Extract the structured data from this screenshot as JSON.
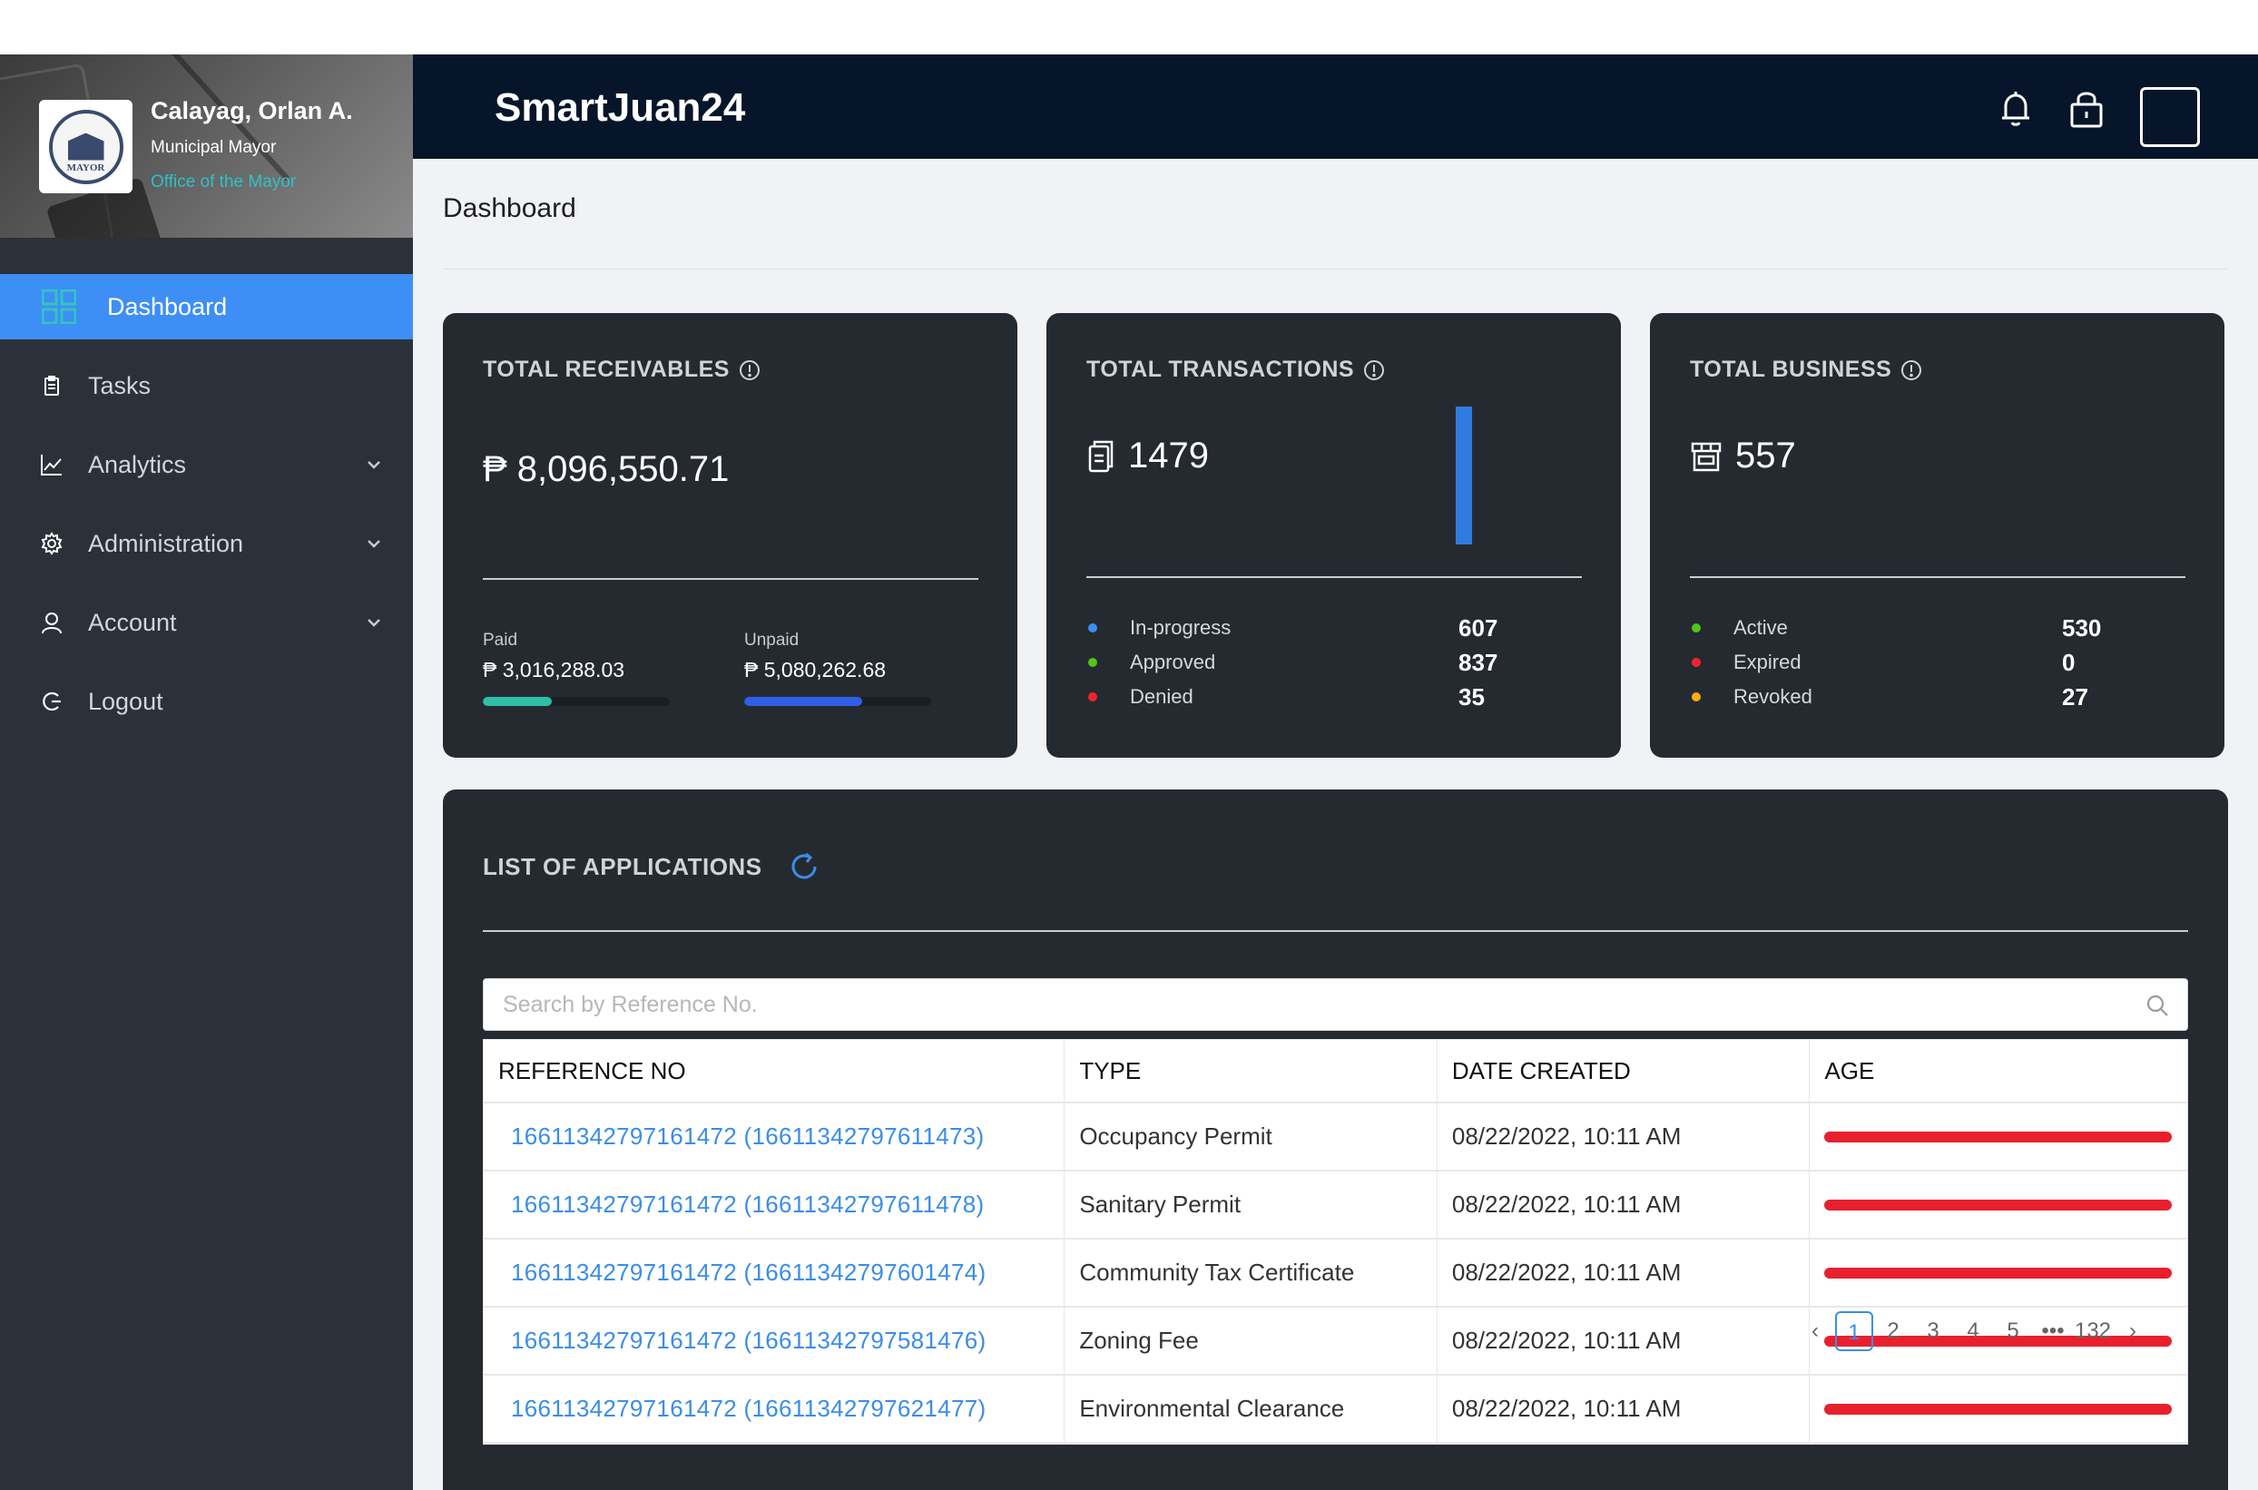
{
  "app": {
    "brand": "SmartJuan24"
  },
  "profile": {
    "name": "Calayag, Orlan A.",
    "role": "Municipal Mayor",
    "office": "Office of the Mayor",
    "seal_text": "MAYOR"
  },
  "sidebar": {
    "items": [
      {
        "label": "Dashboard",
        "icon": "dashboard-grid-icon",
        "active": true
      },
      {
        "label": "Tasks",
        "icon": "clipboard-icon"
      },
      {
        "label": "Analytics",
        "icon": "line-chart-icon",
        "expandable": true
      },
      {
        "label": "Administration",
        "icon": "gear-icon",
        "expandable": true
      },
      {
        "label": "Account",
        "icon": "user-icon",
        "expandable": true
      },
      {
        "label": "Logout",
        "icon": "logout-icon"
      }
    ]
  },
  "header": {
    "icons": [
      "bell-icon",
      "lock-icon",
      "menu-box-icon"
    ]
  },
  "page": {
    "title": "Dashboard"
  },
  "cards": {
    "receivables": {
      "title": "TOTAL RECEIVABLES",
      "amount": "₱ 8,096,550.71",
      "paid_label": "Paid",
      "paid_value": "₱ 3,016,288.03",
      "paid_progress": 0.37,
      "unpaid_label": "Unpaid",
      "unpaid_value": "₱ 5,080,262.68",
      "unpaid_progress": 0.63
    },
    "transactions": {
      "title": "TOTAL TRANSACTIONS",
      "total": "1479",
      "rows": [
        {
          "label": "In-progress",
          "value": "607",
          "color": "#3d8ff5"
        },
        {
          "label": "Approved",
          "value": "837",
          "color": "#52c41a"
        },
        {
          "label": "Denied",
          "value": "35",
          "color": "#f5222d"
        }
      ]
    },
    "business": {
      "title": "TOTAL BUSINESS",
      "total": "557",
      "rows": [
        {
          "label": "Active",
          "value": "530",
          "color": "#52c41a"
        },
        {
          "label": "Expired",
          "value": "0",
          "color": "#f5222d"
        },
        {
          "label": "Revoked",
          "value": "27",
          "color": "#faad14"
        }
      ]
    }
  },
  "applications": {
    "title": "LIST OF APPLICATIONS",
    "search_placeholder": "Search by Reference No.",
    "columns": [
      "REFERENCE NO",
      "TYPE",
      "DATE CREATED",
      "AGE"
    ],
    "rows": [
      {
        "ref": "16611342797161472 (16611342797611473)",
        "type": "Occupancy Permit",
        "date": "08/22/2022, 10:11 AM"
      },
      {
        "ref": "16611342797161472 (16611342797611478)",
        "type": "Sanitary Permit",
        "date": "08/22/2022, 10:11 AM"
      },
      {
        "ref": "16611342797161472 (16611342797601474)",
        "type": "Community Tax Certificate",
        "date": "08/22/2022, 10:11 AM"
      },
      {
        "ref": "16611342797161472 (16611342797581476)",
        "type": "Zoning Fee",
        "date": "08/22/2022, 10:11 AM"
      },
      {
        "ref": "16611342797161472 (16611342797621477)",
        "type": "Environmental Clearance",
        "date": "08/22/2022, 10:11 AM"
      }
    ],
    "age_color": "#e8202e",
    "pagination": [
      "1",
      "2",
      "3",
      "4",
      "5",
      "•••",
      "132"
    ],
    "current_page": "1"
  },
  "colors": {
    "accent": "#3d8ff5",
    "header_bg": "#061529",
    "sidebar_bg": "#2b3138",
    "card_bg": "#252a31",
    "paid_bar": "#2fbfa7",
    "unpaid_bar": "#2f5fe8"
  }
}
